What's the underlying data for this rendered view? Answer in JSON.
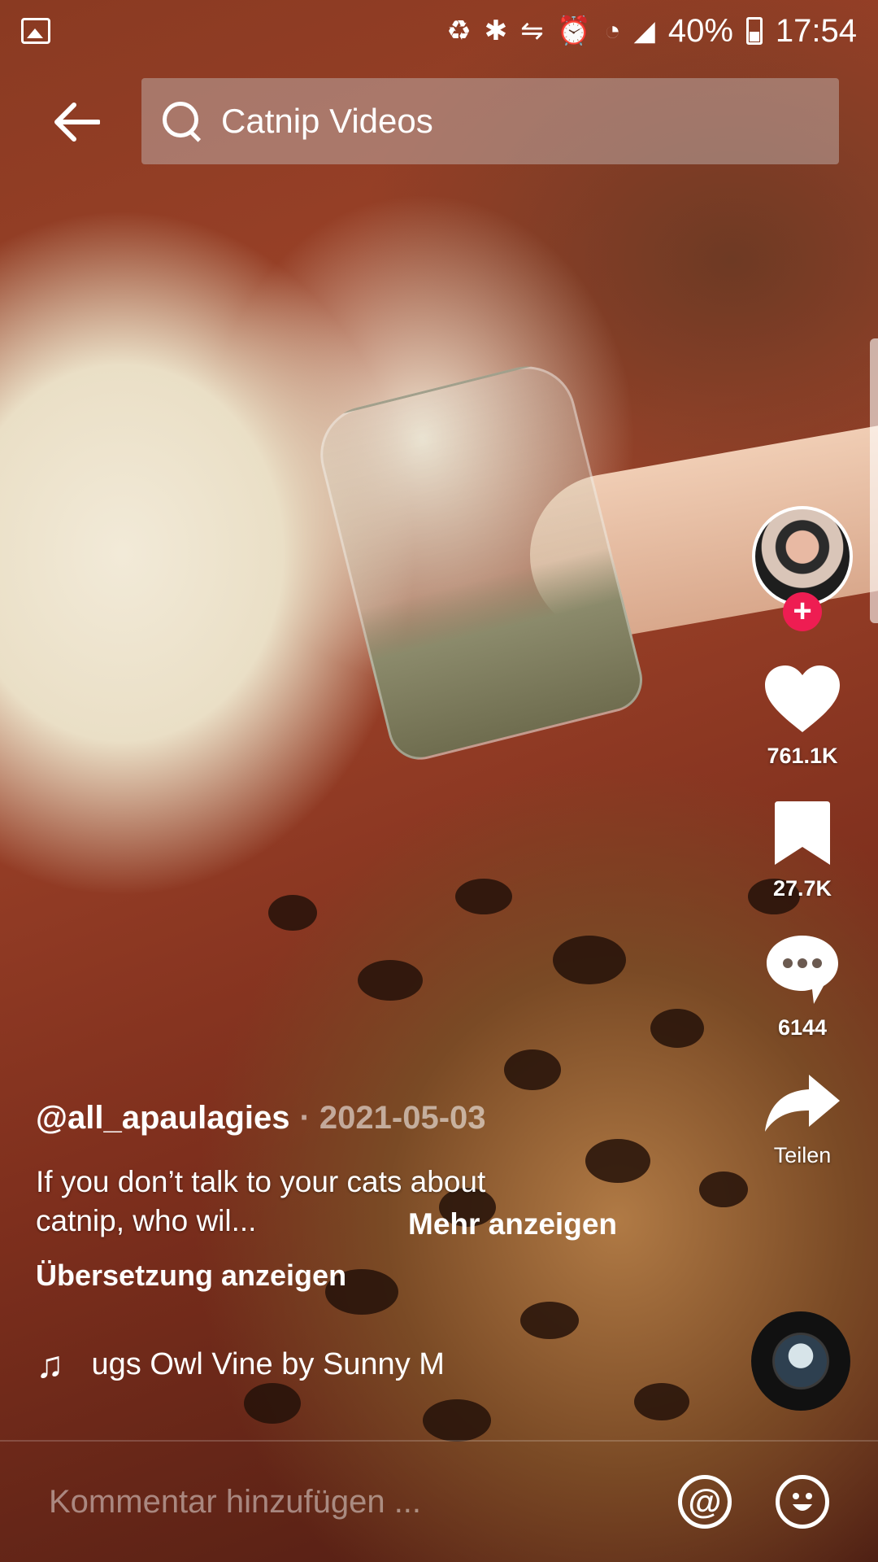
{
  "status_bar": {
    "battery": "40%",
    "time": "17:54"
  },
  "header": {
    "search_query": "Catnip Videos"
  },
  "actions": {
    "likes": "761.1K",
    "saves": "27.7K",
    "comments": "6144",
    "share_label": "Teilen"
  },
  "post": {
    "username": "@all_apaulagies",
    "date": "· 2021-05-03",
    "caption_line1": "If you don’t talk to your cats about",
    "caption_line2": "catnip, who wil...",
    "more_label": "Mehr anzeigen",
    "translate_label": "Übersetzung anzeigen",
    "music": "ugs Owl Vine by Sunny M"
  },
  "comment_bar": {
    "placeholder": "Kommentar hinzufügen ..."
  },
  "colors": {
    "follow_accent": "#ee1d52"
  }
}
